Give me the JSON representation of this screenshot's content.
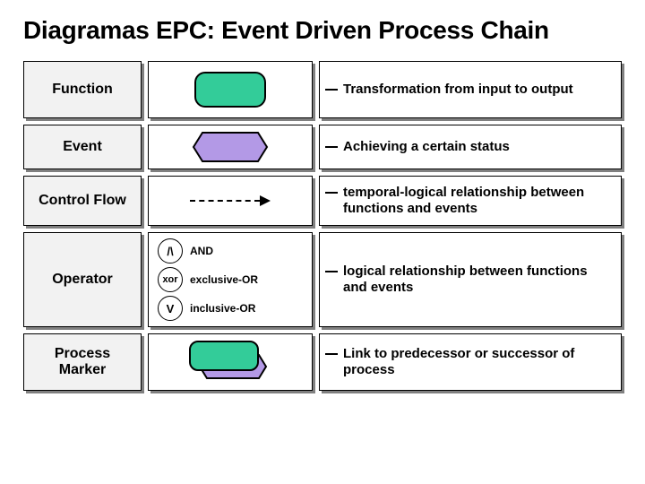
{
  "title": "Diagramas EPC: Event Driven Process Chain",
  "rows": {
    "function": {
      "label": "Function",
      "desc": "Transformation from input to output"
    },
    "event": {
      "label": "Event",
      "desc": "Achieving a certain status"
    },
    "control_flow": {
      "label": "Control Flow",
      "desc": "temporal-logical relationship between functions and events"
    },
    "operator": {
      "label": "Operator",
      "ops": [
        {
          "sym": "/\\",
          "name": "AND"
        },
        {
          "sym": "xor",
          "name": "exclusive-OR"
        },
        {
          "sym": "V",
          "name": "inclusive-OR"
        }
      ],
      "desc": "logical relationship between functions and events"
    },
    "process_marker": {
      "label": "Process Marker",
      "desc": "Link to predecessor or successor of process"
    }
  },
  "colors": {
    "function_fill": "#33cc99",
    "event_fill": "#b399e6",
    "label_bg": "#f2f2f2"
  }
}
